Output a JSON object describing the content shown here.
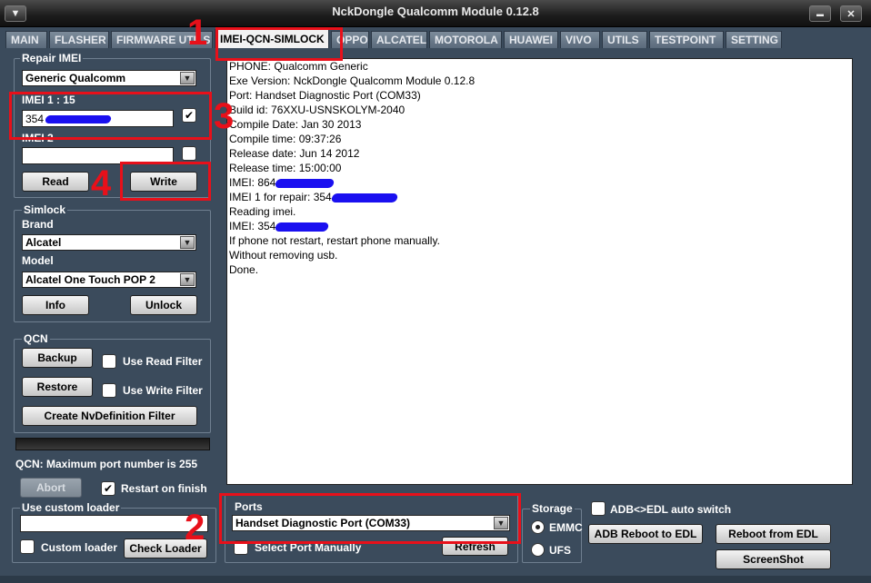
{
  "window": {
    "title": "NckDongle Qualcomm Module 0.12.8",
    "menu_glyph": "▼",
    "minimize_glyph": "▬",
    "close_glyph": "✕"
  },
  "tabs": [
    {
      "label": "MAIN"
    },
    {
      "label": "FLASHER"
    },
    {
      "label": "FIRMWARE UTILS"
    },
    {
      "label": "IMEI-QCN-SIMLOCK",
      "active": true
    },
    {
      "label": "OPPO"
    },
    {
      "label": "ALCATEL"
    },
    {
      "label": "MOTOROLA"
    },
    {
      "label": "HUAWEI"
    },
    {
      "label": "VIVO"
    },
    {
      "label": "UTILS"
    },
    {
      "label": "TESTPOINT"
    },
    {
      "label": "SETTING"
    }
  ],
  "repair_imei": {
    "title": "Repair IMEI",
    "chipset": "Generic Qualcomm",
    "imei1_label": "IMEI 1 : 15",
    "imei1_value": "354",
    "imei1_checked": "✔",
    "imei2_label": "IMEI 2",
    "imei2_value": "",
    "read_label": "Read",
    "write_label": "Write"
  },
  "simlock": {
    "title": "Simlock",
    "brand_label": "Brand",
    "brand_value": "Alcatel",
    "model_label": "Model",
    "model_value": "Alcatel One Touch POP 2",
    "info_label": "Info",
    "unlock_label": "Unlock"
  },
  "qcn": {
    "title": "QCN",
    "backup_label": "Backup",
    "use_read_filter": "Use Read Filter",
    "restore_label": "Restore",
    "use_write_filter": "Use Write Filter",
    "create_nv_label": "Create NvDefinition Filter",
    "status": "QCN: Maximum port number is 255"
  },
  "abort_label": "Abort",
  "restart_on_finish": "Restart on finish",
  "restart_checked": "✔",
  "custom_loader": {
    "title": "Use custom loader",
    "value": "",
    "checkbox_label": "Custom loader",
    "check_label": "Check Loader"
  },
  "log": {
    "lines": [
      {
        "text": "PHONE: Qualcomm Generic"
      },
      {
        "text": "Exe Version: NckDongle Qualcomm Module 0.12.8"
      },
      {
        "text": "Port: Handset Diagnostic Port (COM33)"
      },
      {
        "text": "Build id: 76XXU-USNSKOLYM-2040"
      },
      {
        "text": "Compile Date: Jan 30 2013"
      },
      {
        "text": "Compile time: 09:37:26"
      },
      {
        "text": "Release date: Jun 14 2012"
      },
      {
        "text": "Release time: 15:00:00"
      },
      {
        "text": "IMEI: 864",
        "redact": true
      },
      {
        "text": "IMEI 1 for repair: 354",
        "redact": true
      },
      {
        "text": "Reading imei."
      },
      {
        "text": "IMEI: 354",
        "redact": true
      },
      {
        "text": "If phone not restart, restart phone manually."
      },
      {
        "text": "Without removing usb."
      },
      {
        "text": "Done."
      }
    ]
  },
  "ports": {
    "title": "Ports",
    "selected": "Handset Diagnostic Port (COM33)",
    "select_manually": "Select Port Manually",
    "refresh_label": "Refresh"
  },
  "storage": {
    "title": "Storage",
    "emmc": "EMMC",
    "ufs": "UFS",
    "selected": "EMMC"
  },
  "adb": {
    "auto_switch": "ADB<>EDL auto switch",
    "reboot_edl": "ADB Reboot to EDL",
    "reboot_from_edl": "Reboot from EDL",
    "screenshot": "ScreenShot"
  },
  "annotations": [
    "1",
    "2",
    "3",
    "4"
  ],
  "colors": {
    "background": "#3b4b5c",
    "annotation": "#e8101a",
    "redaction": "#1a10f0"
  }
}
